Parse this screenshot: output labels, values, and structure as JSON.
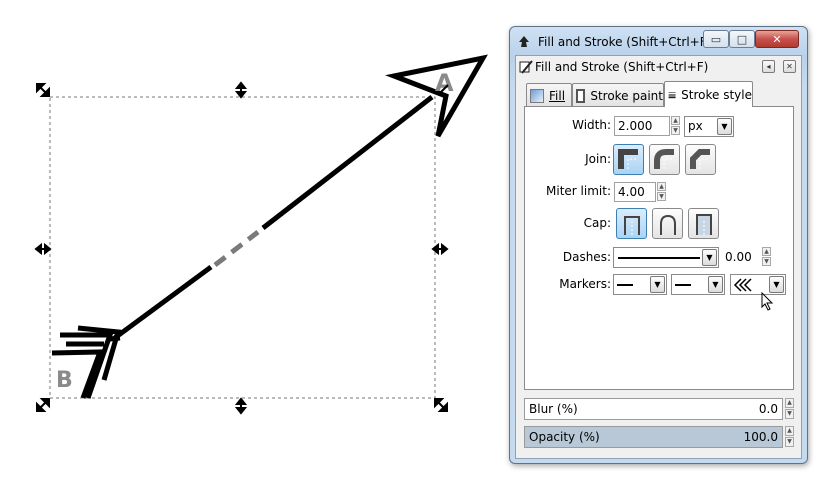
{
  "canvas": {
    "label_a": "A",
    "label_b": "B"
  },
  "window": {
    "title": "Fill and Stroke (Shift+Ctrl+F)",
    "buttons": {
      "minimize": "▭",
      "maximize": "□",
      "close": "✕"
    }
  },
  "dock": {
    "title": "Fill and Stroke (Shift+Ctrl+F)",
    "back": "◂",
    "close": "✕"
  },
  "tabs": [
    {
      "label": "Fill",
      "icon": "fill-icon"
    },
    {
      "label": "Stroke paint",
      "icon": "stroke-paint-icon"
    },
    {
      "label": "Stroke style",
      "icon": "stroke-style-icon",
      "active": true
    }
  ],
  "stroke_style": {
    "width_label": "Width:",
    "width_value": "2.000",
    "unit_value": "px",
    "join_label": "Join:",
    "miter_label": "Miter limit:",
    "miter_value": "4.00",
    "cap_label": "Cap:",
    "dashes_label": "Dashes:",
    "dash_offset": "0.00",
    "markers_label": "Markers:"
  },
  "blur": {
    "label": "Blur (%)",
    "value": "0.0",
    "fraction": 0
  },
  "opacity": {
    "label": "Opacity (%)",
    "value": "100.0",
    "fraction": 1
  },
  "colors": {
    "accent_blue": "#a9d4f4",
    "title_gradient": "#b9d1ea",
    "close_red": "#c75050",
    "arrow_black": "#000000",
    "dash_gray": "#808080"
  }
}
